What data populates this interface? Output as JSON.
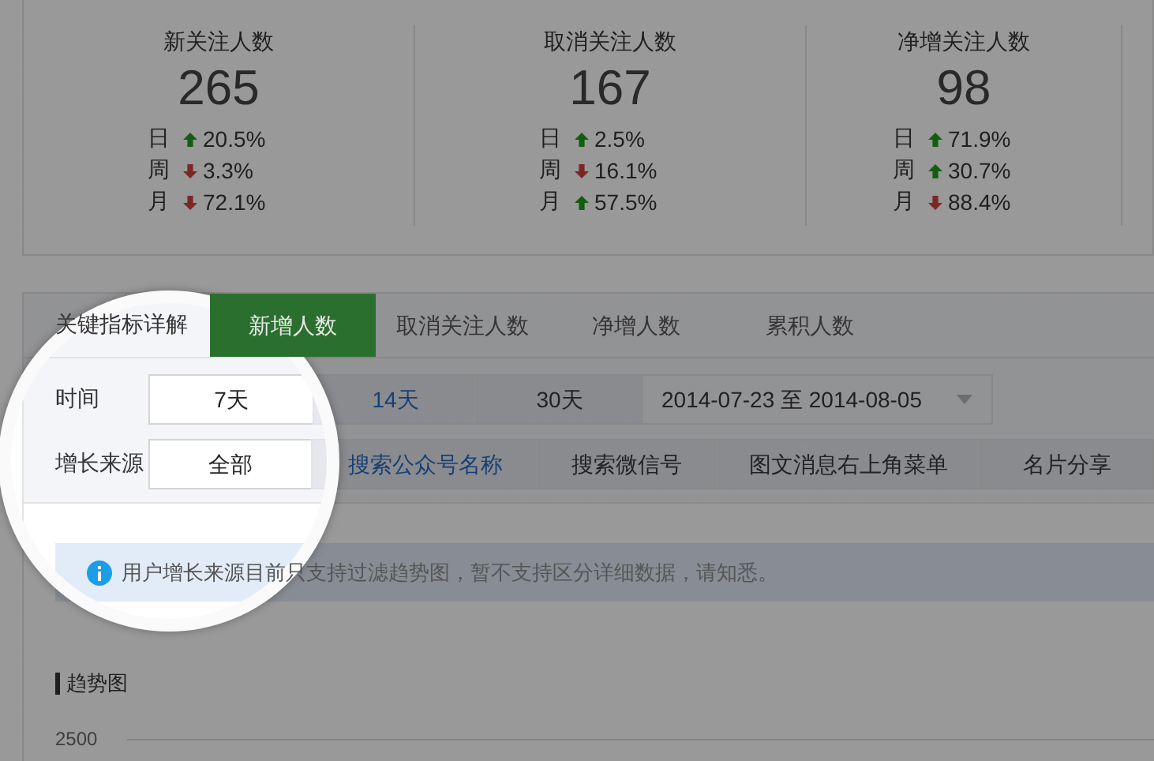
{
  "stats": [
    {
      "label": "新关注人数",
      "value": "265",
      "changes": [
        {
          "period": "日",
          "rising": true,
          "percent": "20.5%"
        },
        {
          "period": "周",
          "rising": false,
          "percent": "3.3%"
        },
        {
          "period": "月",
          "rising": false,
          "percent": "72.1%"
        }
      ]
    },
    {
      "label": "取消关注人数",
      "value": "167",
      "changes": [
        {
          "period": "日",
          "rising": true,
          "percent": "2.5%"
        },
        {
          "period": "周",
          "rising": false,
          "percent": "16.1%"
        },
        {
          "period": "月",
          "rising": true,
          "percent": "57.5%"
        }
      ]
    },
    {
      "label": "净增关注人数",
      "value": "98",
      "changes": [
        {
          "period": "日",
          "rising": true,
          "percent": "71.9%"
        },
        {
          "period": "周",
          "rising": true,
          "percent": "30.7%"
        },
        {
          "period": "月",
          "rising": false,
          "percent": "88.4%"
        }
      ]
    }
  ],
  "section_title": "关键指标详解",
  "tabs": [
    {
      "label": "新增人数",
      "selected": true
    },
    {
      "label": "取消关注人数",
      "selected": false
    },
    {
      "label": "净增人数",
      "selected": false
    },
    {
      "label": "累积人数",
      "selected": false
    }
  ],
  "filters": [
    {
      "label": "时间",
      "options": [
        {
          "label": "7天",
          "selected": true,
          "hover": false
        },
        {
          "label": "14天",
          "selected": false,
          "hover": true
        },
        {
          "label": "30天",
          "selected": false,
          "hover": false
        }
      ],
      "date_range": "2014-07-23 至 2014-08-05"
    },
    {
      "label": "增长来源",
      "options": [
        {
          "label": "全部",
          "selected": true,
          "hover": false
        },
        {
          "label": "搜索公众号名称",
          "selected": false,
          "hover": true
        },
        {
          "label": "搜索微信号",
          "selected": false,
          "hover": false
        },
        {
          "label": "图文消息右上角菜单",
          "selected": false,
          "hover": false
        },
        {
          "label": "名片分享",
          "selected": false,
          "hover": false
        }
      ]
    }
  ],
  "notice": "用户增长来源目前只支持过滤趋势图，暂不支持区分详细数据，请知悉。",
  "chart_title": "趋势图",
  "y_tick": "2500"
}
